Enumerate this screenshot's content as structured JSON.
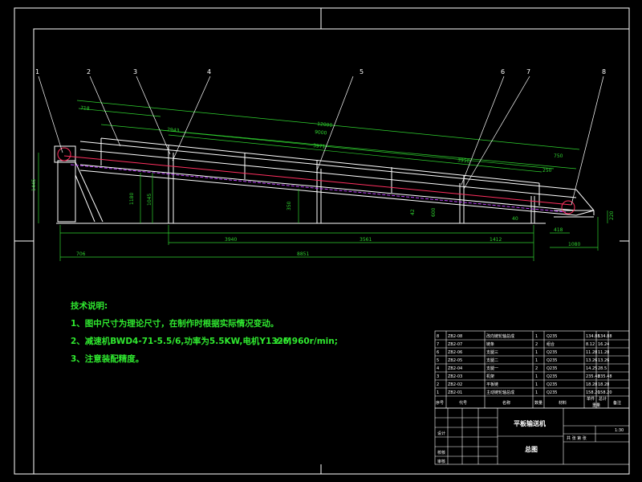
{
  "colors": {
    "background": "#000000",
    "frame": "#ffffff",
    "structure": "#ffffff",
    "dimension": "#2fd12f",
    "chain": "#ff3060",
    "notes": "#2fe82f",
    "hatch_dash": "#c040ff"
  },
  "balloons": [
    "1",
    "2",
    "3",
    "4",
    "5",
    "6",
    "7",
    "8"
  ],
  "dimensions": {
    "d_718": "718",
    "d_1200": "12000",
    "d_9000": "9000",
    "d_2943": "2943",
    "d_3971": "3971",
    "d_3950": "3950",
    "d_250": "250",
    "d_750": "750",
    "d_1445": "1445",
    "d_1180": "1180",
    "d_1045": "1045",
    "d_350": "350",
    "d_3940": "3940",
    "d_3561": "3561",
    "d_1412": "1412",
    "d_706": "706",
    "d_8851": "8851",
    "d_418": "418",
    "d_1080": "1080",
    "d_220": "220",
    "d_42": "42",
    "d_40": "40",
    "d_600": "600"
  },
  "notes": {
    "title": "技术说明:",
    "line1": "1、图中尺寸为理论尺寸，在制作时根据实际情况变动。",
    "line2": "2、减速机BWD4-71-5.5/6,功率为5.5KW,电机Y132M",
    "line2b": "z-6,960r/min;",
    "line3": "3、注意装配精度。"
  },
  "bom": [
    {
      "no": "8",
      "code": "ZB2-08",
      "name": "改向链轮轴总成",
      "qty": "1",
      "mat": "Q235",
      "w1": "134.88",
      "w2": "134.88"
    },
    {
      "no": "7",
      "code": "ZB2-07",
      "name": "链条",
      "qty": "2",
      "mat": "组合",
      "w1": "8.12",
      "w2": "16.24"
    },
    {
      "no": "6",
      "code": "ZB2-06",
      "name": "支腿三",
      "qty": "1",
      "mat": "Q235",
      "w1": "11.28",
      "w2": "11.28"
    },
    {
      "no": "5",
      "code": "ZB2-05",
      "name": "支腿二",
      "qty": "1",
      "mat": "Q235",
      "w1": "13.26",
      "w2": "13.26"
    },
    {
      "no": "4",
      "code": "ZB2-04",
      "name": "支腿一",
      "qty": "2",
      "mat": "Q235",
      "w1": "14.25",
      "w2": "28.5"
    },
    {
      "no": "3",
      "code": "ZB2-03",
      "name": "机架",
      "qty": "1",
      "mat": "Q235",
      "w1": "235.48",
      "w2": "235.48"
    },
    {
      "no": "2",
      "code": "ZB2-02",
      "name": "平板链",
      "qty": "1",
      "mat": "Q235",
      "w1": "18.28",
      "w2": "18.28"
    },
    {
      "no": "1",
      "code": "ZB2-01",
      "name": "主动链轮轴总成",
      "qty": "1",
      "mat": "Q235",
      "w1": "158.20",
      "w2": "158.20"
    }
  ],
  "bom_header": {
    "no": "序号",
    "code": "代号",
    "name": "名称",
    "qty": "数量",
    "mat": "材料",
    "unit_weight": "单件",
    "total_weight": "总计",
    "weight": "重量",
    "remark": "备注"
  },
  "title_block": {
    "drawing_name": "平板输送机",
    "company": "总图",
    "scale": "1:30",
    "sheet": "共  张   第  张",
    "design": "设计",
    "check": "校核",
    "approve": "审核"
  }
}
